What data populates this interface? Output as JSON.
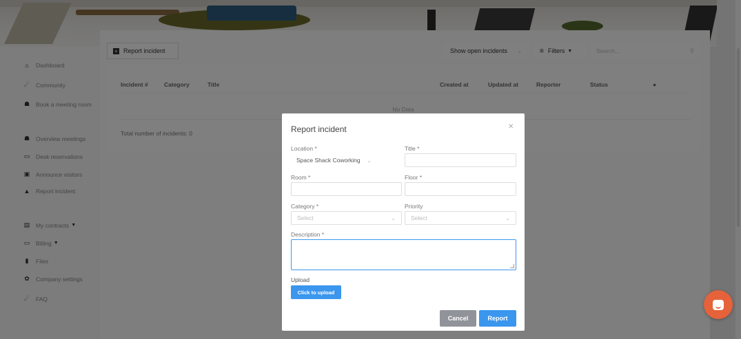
{
  "sidebar": {
    "items": [
      {
        "icon": "home-icon",
        "glyph": "⌂",
        "label": "Dashboard"
      },
      {
        "icon": "community-icon",
        "glyph": "☄",
        "label": "Community"
      },
      {
        "icon": "meeting-room-icon",
        "glyph": "☗",
        "label": "Book a meeting room"
      },
      {
        "icon": "meetings-overview-icon",
        "glyph": "☗",
        "label": "Overview meetings"
      },
      {
        "icon": "laptop-icon",
        "glyph": "▭",
        "label": "Desk reservations"
      },
      {
        "icon": "visitors-icon",
        "glyph": "▣",
        "label": "Announce visitors"
      },
      {
        "icon": "warning-icon",
        "glyph": "▲",
        "label": "Report incident"
      },
      {
        "icon": "contracts-icon",
        "glyph": "▤",
        "label": "My contracts"
      },
      {
        "icon": "billing-icon",
        "glyph": "▭",
        "label": "Billing"
      },
      {
        "icon": "files-icon",
        "glyph": "▮",
        "label": "Files"
      },
      {
        "icon": "settings-icon",
        "glyph": "✿",
        "label": "Company settings"
      },
      {
        "icon": "faq-icon",
        "glyph": "☄",
        "label": "FAQ"
      }
    ]
  },
  "toolbar": {
    "report_label": "Report incident",
    "filter_select": "Show open incidents",
    "filters_label": "Filters",
    "search_placeholder": "Search..."
  },
  "table": {
    "columns": [
      "Incident #",
      "Category",
      "Title",
      "Created at",
      "Updated at",
      "Reporter",
      "Status"
    ],
    "empty_text": "No Data",
    "total_text": "Total number of incidents: 0"
  },
  "modal": {
    "title": "Report incident",
    "location_label": "Location *",
    "location_value": "Space Shack Coworking",
    "title_label": "Title *",
    "room_label": "Room *",
    "floor_label": "Floor *",
    "category_label": "Category *",
    "category_placeholder": "Select",
    "priority_label": "Priority",
    "priority_placeholder": "Select",
    "description_label": "Description *",
    "upload_label": "Upload",
    "upload_button": "Click to upload",
    "cancel_button": "Cancel",
    "report_button": "Report"
  },
  "colors": {
    "primary": "#3b96ee",
    "chat": "#e5623a",
    "cancel": "#909399"
  }
}
